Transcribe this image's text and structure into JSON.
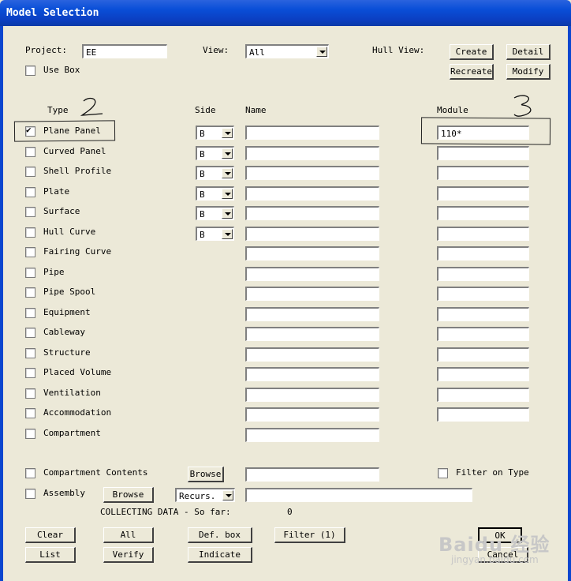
{
  "window": {
    "title": "Model Selection"
  },
  "header": {
    "project_label": "Project:",
    "project_value": "EE",
    "view_label": "View:",
    "view_value": "All",
    "hull_view_label": "Hull View:",
    "use_box_label": "Use Box",
    "buttons": {
      "create": "Create",
      "detail": "Detail",
      "recreate": "Recreate",
      "modify": "Modify"
    }
  },
  "columns": {
    "type": "Type",
    "side": "Side",
    "name": "Name",
    "module": "Module"
  },
  "types": [
    {
      "label": "Plane Panel",
      "checked": true
    },
    {
      "label": "Curved Panel",
      "checked": false
    },
    {
      "label": "Shell Profile",
      "checked": false
    },
    {
      "label": "Plate",
      "checked": false
    },
    {
      "label": "Surface",
      "checked": false
    },
    {
      "label": "Hull Curve",
      "checked": false
    },
    {
      "label": "Fairing Curve",
      "checked": false
    },
    {
      "label": "Pipe",
      "checked": false
    },
    {
      "label": "Pipe Spool",
      "checked": false
    },
    {
      "label": "Equipment",
      "checked": false
    },
    {
      "label": "Cableway",
      "checked": false
    },
    {
      "label": "Structure",
      "checked": false
    },
    {
      "label": "Placed Volume",
      "checked": false
    },
    {
      "label": "Ventilation",
      "checked": false
    },
    {
      "label": "Accommodation",
      "checked": false
    },
    {
      "label": "Compartment",
      "checked": false
    }
  ],
  "side_values": [
    "B",
    "B",
    "B",
    "B",
    "B",
    "B"
  ],
  "module_values": [
    "110*"
  ],
  "bottom": {
    "compartment_contents_label": "Compartment Contents",
    "browse_label": "Browse",
    "filter_on_type_label": "Filter on Type",
    "assembly_label": "Assembly",
    "recurs_value": "Recurs.",
    "collecting_label": "COLLECTING DATA - So far:",
    "collecting_count": "0"
  },
  "actions": {
    "clear": "Clear",
    "all": "All",
    "def_box": "Def. box",
    "filter": "Filter (1)",
    "ok": "OK",
    "list": "List",
    "verify": "Verify",
    "indicate": "Indicate",
    "cancel": "Cancel"
  },
  "annotations": {
    "mark_type": "2",
    "mark_module": "3"
  },
  "watermark": {
    "brand": "Baidu 经验",
    "url": "jingyan.baidu.com"
  }
}
